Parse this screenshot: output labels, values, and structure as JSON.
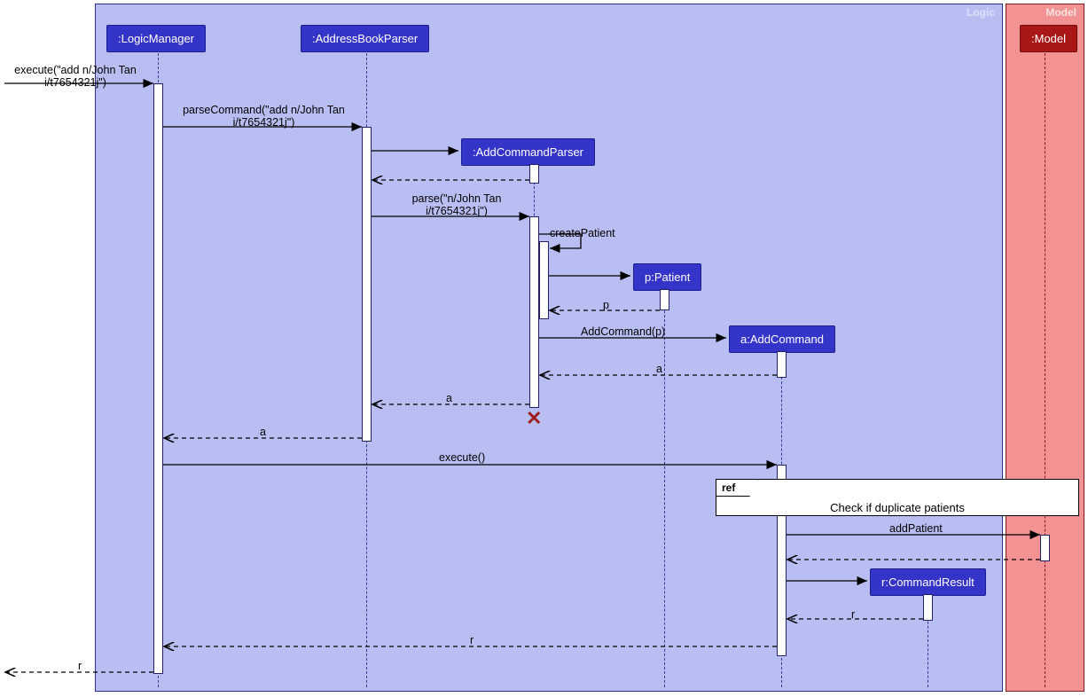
{
  "frames": {
    "logic": "Logic",
    "model": "Model"
  },
  "participants": {
    "logicManager": ":LogicManager",
    "addressBookParser": ":AddressBookParser",
    "addCommandParser": ":AddCommandParser",
    "patient": "p:Patient",
    "addCommand": "a:AddCommand",
    "commandResult": "r:CommandResult",
    "model": ":Model"
  },
  "messages": {
    "m1": "execute(\"add n/John Tan\ni/t7654321j\")",
    "m2": "parseCommand(\"add n/John Tan\ni/t7654321j\")",
    "m3": "parse(\"n/John Tan\ni/t7654321j\")",
    "m4": "createPatient",
    "m5": "p",
    "m6": "AddCommand(p)",
    "m7": "a",
    "m8": "a",
    "m9": "a",
    "m10": "execute()",
    "m11": "addPatient",
    "m12": "r",
    "m13": "r",
    "m14": "r"
  },
  "ref": {
    "tab": "ref",
    "text": "Check if duplicate patients"
  }
}
